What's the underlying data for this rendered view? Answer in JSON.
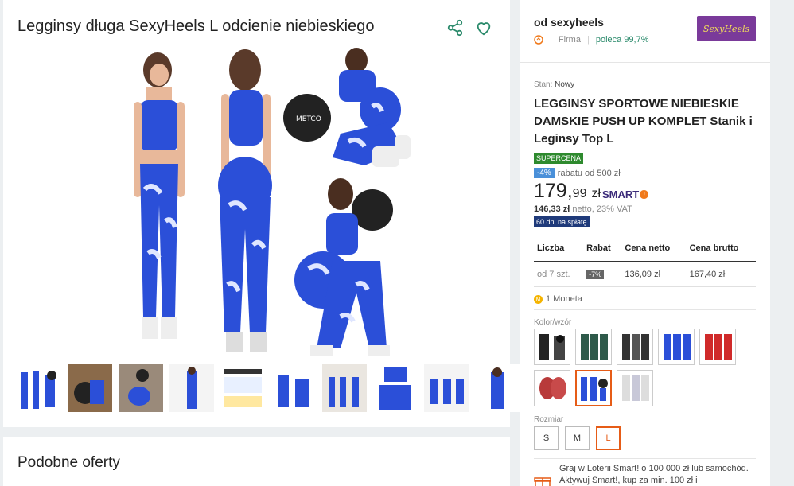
{
  "product": {
    "title": "Legginsy długa SexyHeels L odcienie niebieskiego",
    "similar_heading": "Podobne oferty",
    "thumbnail_count": 10
  },
  "seller": {
    "name": "od sexyheels",
    "type": "Firma",
    "recommend": "poleca 99,7%",
    "logo_text": "SexyHeels"
  },
  "offer": {
    "condition_label": "Stan:",
    "condition_value": "Nowy",
    "title": "LEGGINSY SPORTOWE NIEBIESKIE DAMSKIE PUSH UP KOMPLET Stanik i Leginsy Top L",
    "supercena": "SUPERCENA",
    "discount_pct": "-4%",
    "discount_text": "rabatu od 500 zł",
    "price_int": "179,",
    "price_dec": "99",
    "price_cur": "zł",
    "smart": "SMART",
    "net_value": "146,33 zł",
    "net_text": "netto, 23% VAT",
    "installments": "60 dni na spłatę"
  },
  "qty_table": {
    "headers": [
      "Liczba",
      "Rabat",
      "Cena netto",
      "Cena brutto"
    ],
    "row": [
      "od 7 szt.",
      "-7%",
      "136,09 zł",
      "167,40 zł"
    ]
  },
  "coins": "1 Moneta",
  "variants": {
    "label": "Kolor/wzór",
    "selected_index": 6,
    "count": 8
  },
  "sizes": {
    "label": "Rozmiar",
    "options": [
      "S",
      "M",
      "L"
    ],
    "selected": "L"
  },
  "lottery_text": "Graj w Loterii Smart! o 100 000 zł lub samochód. Aktywuj Smart!, kup za min. 100 zł i",
  "colors": {
    "accent": "#e65c17",
    "teal": "#2a8a6b",
    "leggings_blue": "#2b4fd8"
  }
}
